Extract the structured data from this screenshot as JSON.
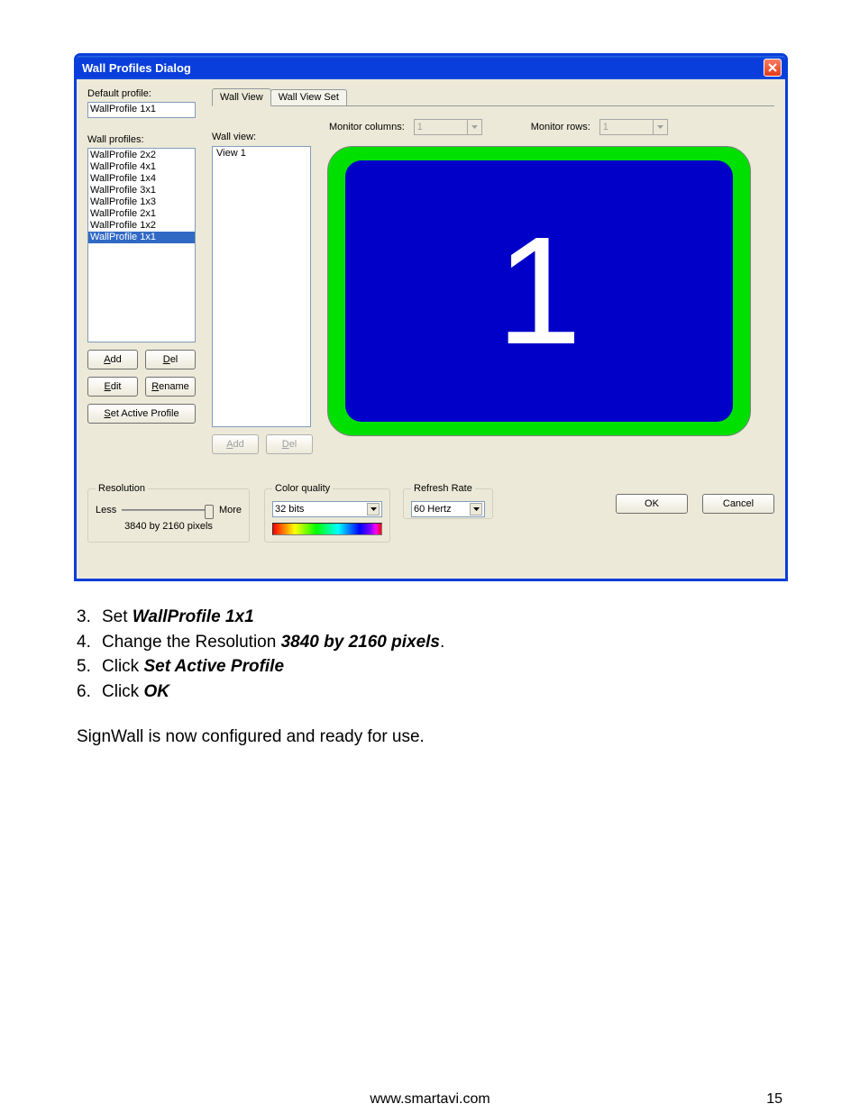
{
  "dialog": {
    "title": "Wall Profiles Dialog",
    "left": {
      "default_label": "Default profile:",
      "default_value": "WallProfile 1x1",
      "profiles_label": "Wall profiles:",
      "profiles": [
        "WallProfile 2x2",
        "WallProfile 4x1",
        "WallProfile 1x4",
        "WallProfile 3x1",
        "WallProfile 1x3",
        "WallProfile 2x1",
        "WallProfile 1x2",
        "WallProfile 1x1"
      ],
      "selected_index": 7,
      "btn_add": "Add",
      "btn_del": "Del",
      "btn_edit": "Edit",
      "btn_rename": "Rename",
      "btn_set_active": "Set Active Profile"
    },
    "right": {
      "tab_view": "Wall View",
      "tab_viewset": "Wall View Set",
      "monitor_cols_label": "Monitor columns:",
      "monitor_cols_value": "1",
      "monitor_rows_label": "Monitor rows:",
      "monitor_rows_value": "1",
      "wallview_label": "Wall view:",
      "wallview_items": [
        "View 1"
      ],
      "preview_number": "1",
      "btn_add": "Add",
      "btn_del": "Del"
    },
    "bottom": {
      "resolution_legend": "Resolution",
      "less": "Less",
      "more": "More",
      "resolution_text": "3840 by 2160 pixels",
      "color_legend": "Color quality",
      "color_value": "32 bits",
      "refresh_legend": "Refresh Rate",
      "refresh_value": "60 Hertz",
      "ok": "OK",
      "cancel": "Cancel"
    }
  },
  "doc": {
    "step3_pre": "Set  ",
    "step3_bold": "WallProfile 1x1",
    "step4_pre": "Change the Resolution ",
    "step4_bold": "3840 by 2160 pixels",
    "step4_post": ".",
    "step5_pre": "Click  ",
    "step5_bold": "Set Active Profile",
    "step6_pre": "Click  ",
    "step6_bold": "OK",
    "final": "SignWall is now configured and ready for use.",
    "url": "www.smartavi.com",
    "page": "15"
  }
}
